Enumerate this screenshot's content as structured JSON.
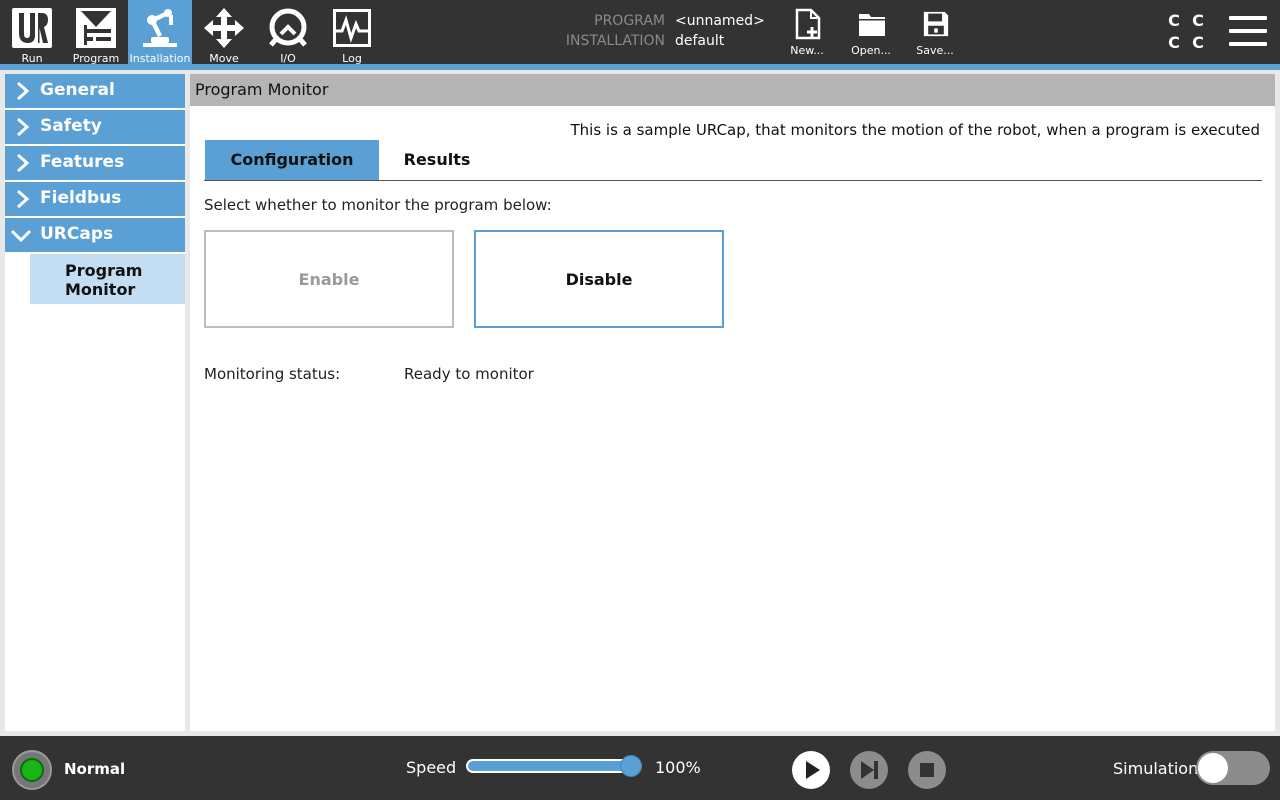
{
  "nav": {
    "run": {
      "label": "Run",
      "icon": "ur-logo-icon"
    },
    "program": {
      "label": "Program",
      "icon": "program-tree-icon"
    },
    "installation": {
      "label": "Installation",
      "icon": "robot-arm-icon",
      "active": true
    },
    "move": {
      "label": "Move",
      "icon": "move-arrows-icon"
    },
    "io": {
      "label": "I/O",
      "icon": "io-icon"
    },
    "log": {
      "label": "Log",
      "icon": "log-graph-icon"
    }
  },
  "program_info": {
    "program_key": "PROGRAM",
    "program_value": "<unnamed>",
    "installation_key": "INSTALLATION",
    "installation_value": "default"
  },
  "file": {
    "new_label": "New...",
    "open_label": "Open...",
    "save_label": "Save..."
  },
  "cbox": [
    "C",
    "C",
    "C",
    "C"
  ],
  "sidebar": {
    "items": [
      {
        "label": "General",
        "expanded": false
      },
      {
        "label": "Safety",
        "expanded": false
      },
      {
        "label": "Features",
        "expanded": false
      },
      {
        "label": "Fieldbus",
        "expanded": false
      },
      {
        "label": "URCaps",
        "expanded": true
      }
    ],
    "sub_item": "Program\nMonitor"
  },
  "main": {
    "title": "Program Monitor",
    "description": "This is a sample URCap, that monitors the motion of the robot, when a program is executed",
    "tabs": [
      {
        "label": "Configuration",
        "active": true
      },
      {
        "label": "Results",
        "active": false
      }
    ],
    "prompt": "Select whether to monitor the program below:",
    "enable_label": "Enable",
    "disable_label": "Disable",
    "status_label": "Monitoring status:",
    "status_value": "Ready to monitor"
  },
  "bottom": {
    "robot_state": "Normal",
    "speed_label": "Speed",
    "speed_value": "100%",
    "speed_fraction": 1.0,
    "simulation_label": "Simulation",
    "simulation_on": false
  },
  "colors": {
    "accent": "#5aa0d4",
    "topbar": "#333333",
    "selected_sub": "#c3ddf2",
    "status_led": "#18b418"
  }
}
